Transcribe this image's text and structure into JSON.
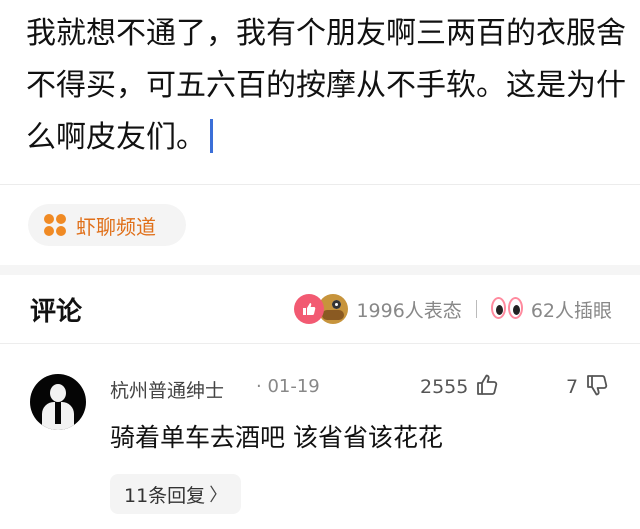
{
  "post": {
    "text": "我就想不通了，我有个朋友啊三两百的衣服舍不得买，可五六百的按摩从不手软。这是为什么啊皮友们。"
  },
  "channel": {
    "label": "虾聊频道",
    "icon": "dots-grid-icon",
    "color": "#f08a24"
  },
  "comments_section": {
    "title": "评论",
    "reaction_count": "1996人表态",
    "grab_count": "62人插眼"
  },
  "comment": {
    "username": "杭州普通绅士",
    "date": "· 01-19",
    "like_count": "2555",
    "dislike_count": "7",
    "text": "骑着单车去酒吧 该省省该花花",
    "replies_label": "11条回复"
  },
  "colors": {
    "accent_orange": "#e0701a",
    "like_pink": "#f25a72",
    "caret_blue": "#3b6fd8"
  }
}
